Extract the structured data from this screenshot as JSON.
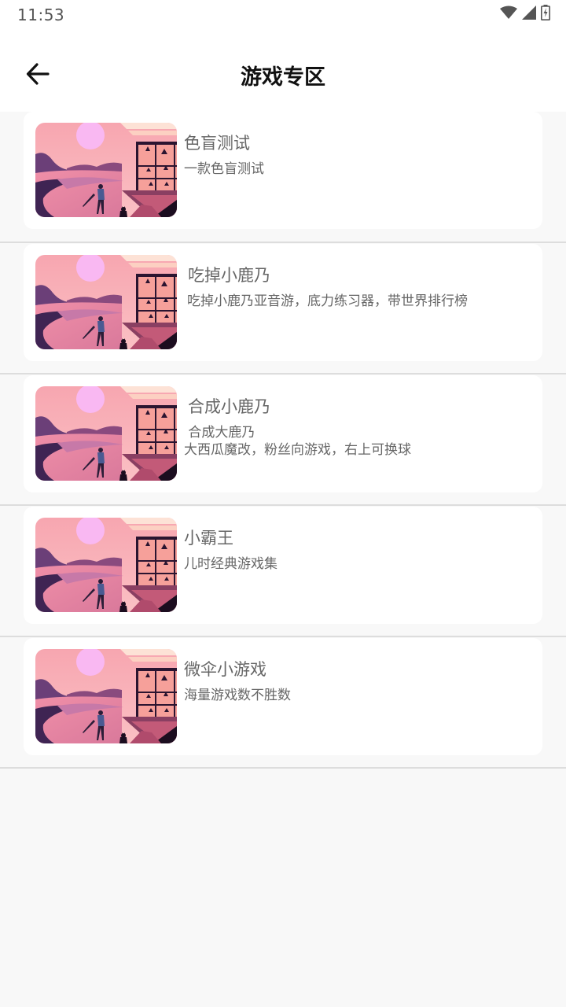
{
  "status_bar": {
    "time": "11:53",
    "icons": [
      "wifi-icon",
      "cell-signal-icon",
      "battery-charging-icon"
    ]
  },
  "app_bar": {
    "back_icon": "arrow-left-icon",
    "title": "游戏专区"
  },
  "games": [
    {
      "title": "色盲测试",
      "description": "一款色盲测试",
      "thumbnail": "sunset-golfer-illustration"
    },
    {
      "title": "吃掉小鹿乃",
      "description": "吃掉小鹿乃亚音游，底力练习器，带世界排行榜",
      "thumbnail": "sunset-golfer-illustration"
    },
    {
      "title": "合成小鹿乃",
      "description": " 合成大鹿乃\n大西瓜魔改，粉丝向游戏，右上可换球",
      "thumbnail": "sunset-golfer-illustration"
    },
    {
      "title": "小霸王",
      "description": "儿时经典游戏集",
      "thumbnail": "sunset-golfer-illustration"
    },
    {
      "title": "微伞小游戏",
      "description": "海量游戏数不胜数",
      "thumbnail": "sunset-golfer-illustration"
    }
  ],
  "colors": {
    "background": "#f8f8f8",
    "card": "#ffffff",
    "text_primary": "#111111",
    "text_secondary": "#666666",
    "divider": "#dddddd"
  }
}
